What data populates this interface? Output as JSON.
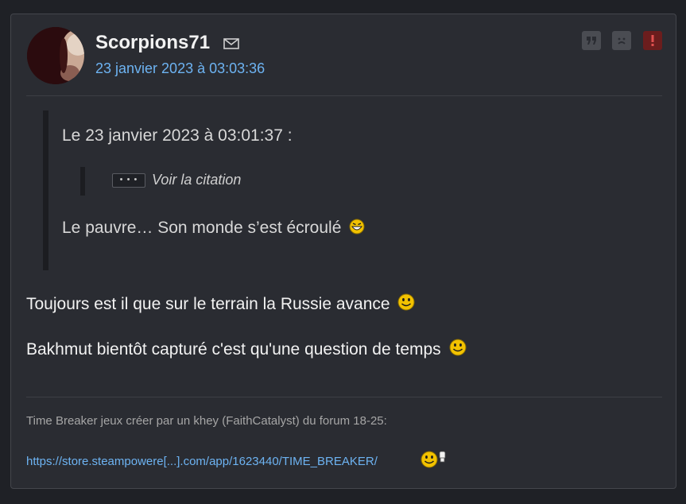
{
  "post": {
    "author": "Scorpions71",
    "date": "23 janvier 2023 à 03:03:36",
    "actions": {
      "quote_icon": "quote-icon",
      "sad_icon": "sad-face-icon",
      "report_icon": "exclamation-icon"
    },
    "quote": {
      "header": "Le 23 janvier 2023 à 03:01:37 :",
      "nested_dots": "• • •",
      "nested_label": "Voir la citation",
      "text": "Le pauvre… Son monde s’est écroulé"
    },
    "body": [
      "Toujours est il que sur le terrain la Russie avance",
      "Bakhmut bientôt capturé c'est qu'une question de temps"
    ],
    "signature": {
      "text": "Time Breaker jeux créer par un khey (FaithCatalyst) du forum 18-25:",
      "link": "https://store.steampowere[...].com/app/1623440/TIME_BREAKER/"
    }
  },
  "colors": {
    "page_bg": "#1f2126",
    "card_bg": "#2a2c32",
    "link": "#6db3f2",
    "report": "#6b1d1d"
  }
}
